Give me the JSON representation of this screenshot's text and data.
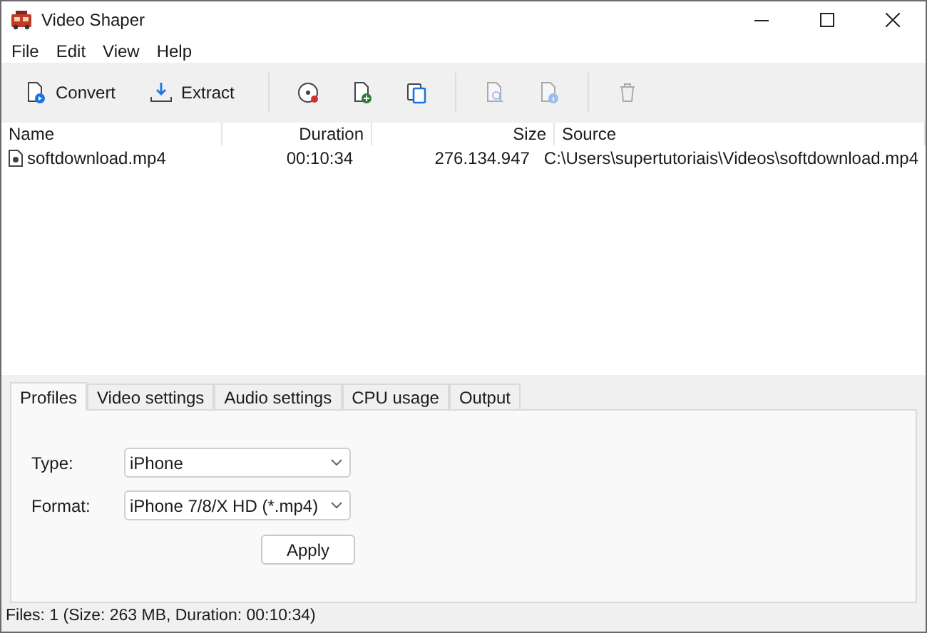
{
  "window": {
    "title": "Video Shaper"
  },
  "menu": [
    "File",
    "Edit",
    "View",
    "Help"
  ],
  "toolbar": [
    {
      "label": "Convert",
      "disabled": false
    },
    {
      "label": "Extract",
      "disabled": false
    },
    {
      "disabled": false
    },
    {
      "disabled": false
    },
    {
      "disabled": false
    },
    {
      "disabled": true
    },
    {
      "disabled": true
    },
    {
      "disabled": true
    }
  ],
  "table": {
    "columns": [
      "Name",
      "Duration",
      "Size",
      "Source"
    ],
    "rows": [
      [
        "softdownload.mp4",
        "00:10:34",
        "276.134.947",
        "C:\\Users\\supertutoriais\\Videos\\softdownload.mp4"
      ]
    ]
  },
  "tabs": [
    {
      "label": "Profiles",
      "selected": true
    },
    {
      "label": "Video settings",
      "selected": false
    },
    {
      "label": "Audio settings",
      "selected": false
    },
    {
      "label": "CPU usage",
      "selected": false
    },
    {
      "label": "Output",
      "selected": false
    }
  ],
  "fields": [
    {
      "label": "Type:",
      "value": "iPhone"
    },
    {
      "label": "Format:",
      "value": "iPhone 7/8/X HD (*.mp4)"
    }
  ],
  "apply_button": "Apply",
  "status_bar": "Files: 1 (Size: 263 MB, Duration: 00:10:34)"
}
